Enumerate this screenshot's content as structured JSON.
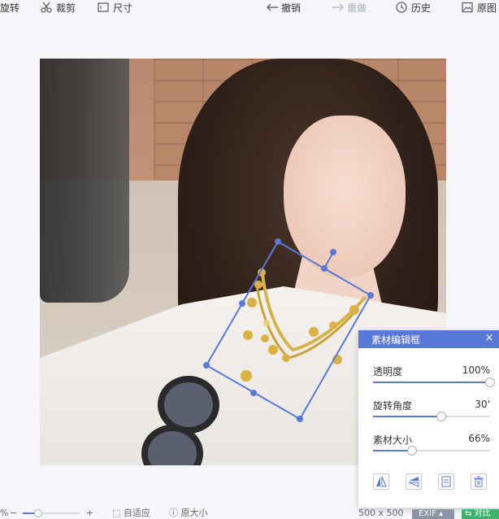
{
  "toolbar": {
    "rotate_label": "旋转",
    "crop_label": "裁剪",
    "size_label": "尺寸",
    "undo_label": "撤销",
    "redo_label": "重做",
    "history_label": "历史",
    "original_label": "原图"
  },
  "panel": {
    "title": "素材编辑框",
    "close_glyph": "×",
    "opacity": {
      "label": "透明度",
      "value_text": "100%",
      "value": 100
    },
    "rotation": {
      "label": "旋转角度",
      "value_text": "30'",
      "value": 30
    },
    "size": {
      "label": "素材大小",
      "value_text": "66%",
      "value": 66
    }
  },
  "bottombar": {
    "zoom_pct_fragment": "%",
    "zoom_minus": "−",
    "zoom_plus": "+",
    "zoom_level": 20,
    "fit_label": "自适应",
    "original_size_label": "原大小",
    "dimensions": "500 x 500",
    "exif_label": "EXIF",
    "compare_label": "对比"
  },
  "colors": {
    "accent": "#5a78d8",
    "panel_header": "#5a78d8",
    "compare_green": "#3db26b",
    "exif_gray": "#8b93a5",
    "background": "#f5f6f9"
  },
  "icons": {
    "rotate": "rotate-icon",
    "crop": "scissors-icon",
    "size": "resize-icon",
    "undo": "arrow-left-icon",
    "redo": "arrow-right-icon",
    "history": "clock-icon",
    "original": "image-icon"
  }
}
